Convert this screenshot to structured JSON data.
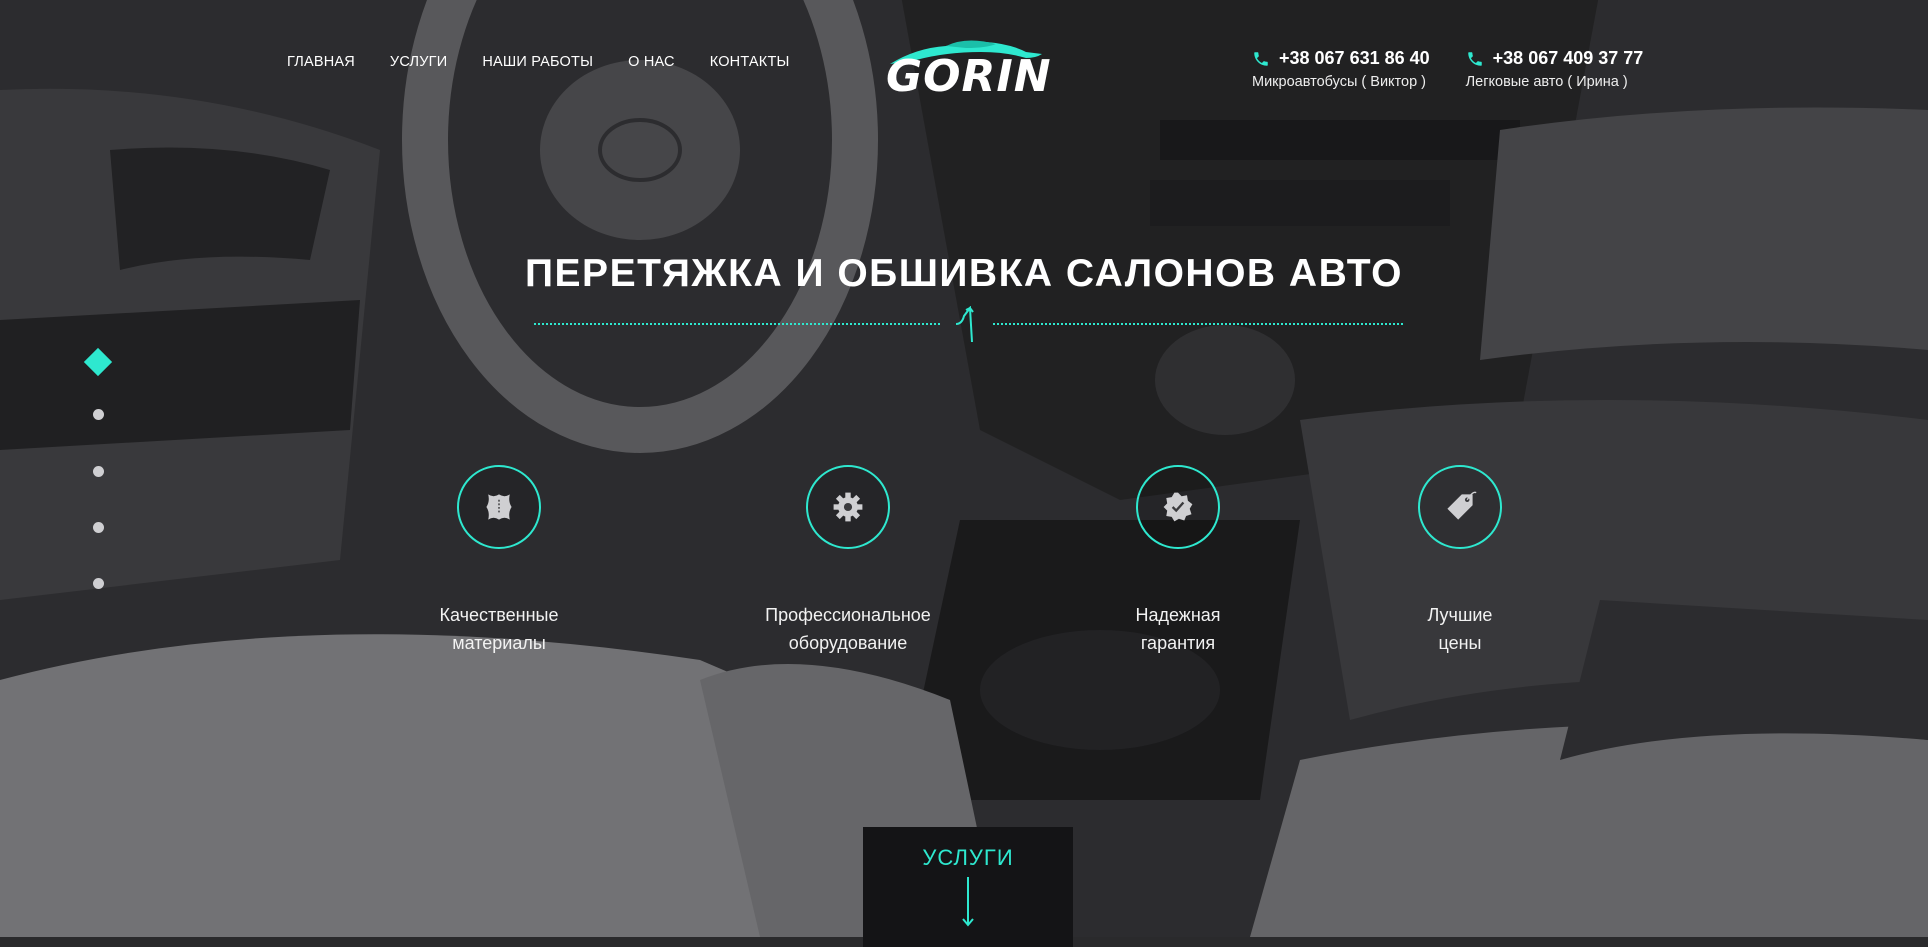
{
  "nav": {
    "items": [
      "ГЛАВНАЯ",
      "УСЛУГИ",
      "НАШИ РАБОТЫ",
      "О НАС",
      "КОНТАКТЫ"
    ]
  },
  "logo": {
    "text": "GORIN"
  },
  "contacts": [
    {
      "phone": "+38 067 631 86 40",
      "note": "Микроавтобусы ( Виктор )"
    },
    {
      "phone": "+38 067 409 37 77",
      "note": "Легковые авто ( Ирина )"
    }
  ],
  "hero": {
    "title": "ПЕРЕТЯЖКА И ОБШИВКА САЛОНОВ АВТО"
  },
  "features": [
    {
      "icon": "leather-icon",
      "label": "Качественные\nматериалы"
    },
    {
      "icon": "gear-icon",
      "label": "Профессиональное\nоборудование"
    },
    {
      "icon": "guarantee-icon",
      "label": "Надежная\nгарантия"
    },
    {
      "icon": "price-tag-icon",
      "label": "Лучшие\nцены"
    }
  ],
  "slider": {
    "count": 5,
    "active": 1
  },
  "services_button": {
    "label": "УСЛУГИ"
  },
  "colors": {
    "accent": "#2ee8cf",
    "dark": "#141416"
  }
}
